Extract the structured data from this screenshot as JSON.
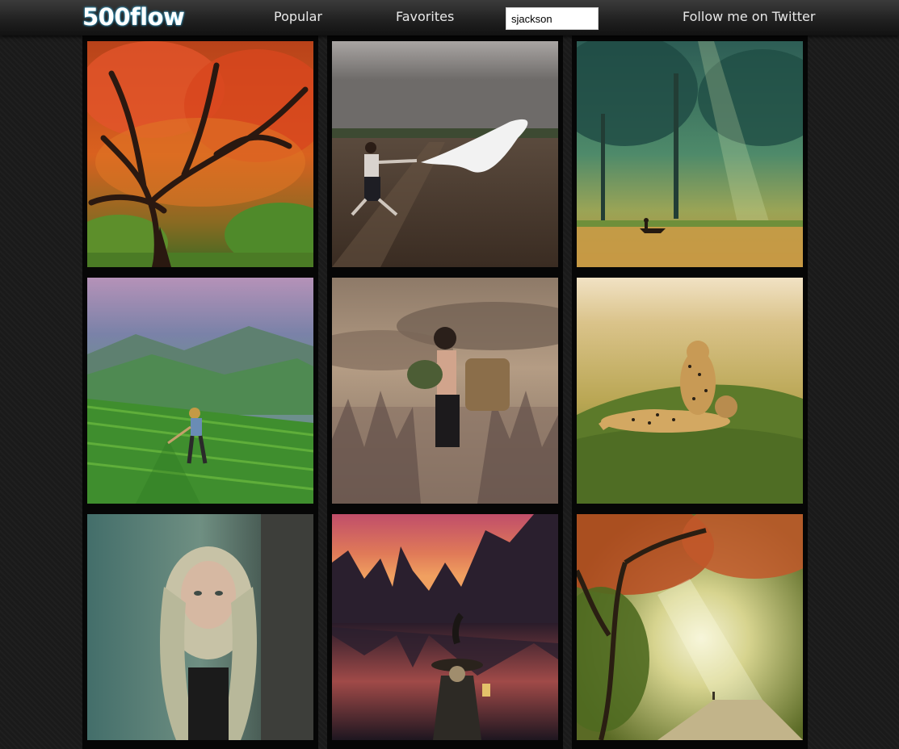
{
  "app": {
    "logo": "500flow"
  },
  "nav": {
    "popular": "Popular",
    "favorites": "Favorites",
    "twitter": "Follow me on Twitter"
  },
  "search": {
    "value": "sjackson"
  },
  "photos": [
    {
      "subject": "red autumn maple tree"
    },
    {
      "subject": "man pulling woman in white dress over field"
    },
    {
      "subject": "misty green forest lake with boat"
    },
    {
      "subject": "farmer in green rice terraces"
    },
    {
      "subject": "girl with basket in field"
    },
    {
      "subject": "cheetah with cubs on grass"
    },
    {
      "subject": "woman with long curly blonde hair"
    },
    {
      "subject": "fisherman with lantern and cormorant at sunset among karst mountains"
    },
    {
      "subject": "sunlit autumn forest road"
    }
  ]
}
